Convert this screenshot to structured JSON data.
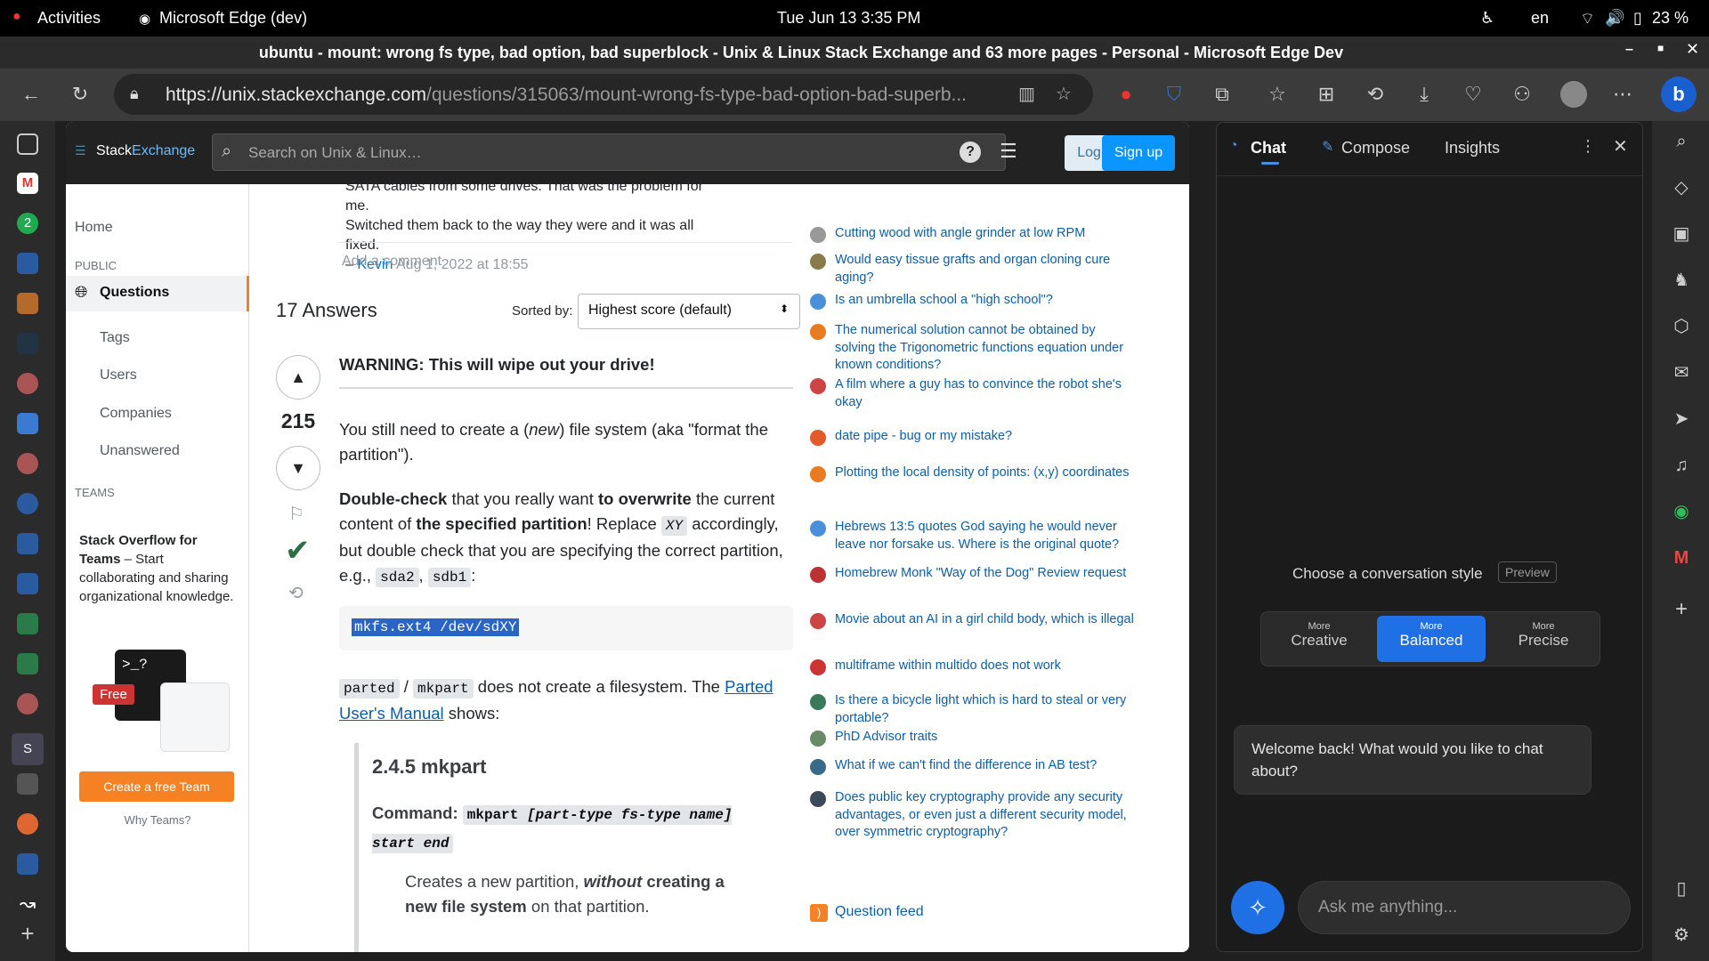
{
  "system": {
    "activities": "Activities",
    "app": "Microsoft Edge (dev)",
    "datetime": "Tue Jun 13  3:35 PM",
    "lang": "en",
    "battery": "23 %"
  },
  "window": {
    "title": "ubuntu - mount: wrong fs type, bad option, bad superblock - Unix & Linux Stack Exchange and 63 more pages - Personal - Microsoft Edge Dev"
  },
  "browser": {
    "url_host": "https://unix.stackexchange.com",
    "url_path": "/questions/315063/mount-wrong-fs-type-bad-option-bad-superb..."
  },
  "se": {
    "logo_a": "Stack",
    "logo_b": "Exchange",
    "search_placeholder": "Search on Unix & Linux…",
    "login": "Log in",
    "signup": "Sign up",
    "nav": {
      "home": "Home",
      "public": "PUBLIC",
      "questions": "Questions",
      "tags": "Tags",
      "users": "Users",
      "companies": "Companies",
      "unanswered": "Unanswered",
      "teams": "TEAMS"
    },
    "teams_box": {
      "title": "Stack Overflow for Teams",
      "text": " – Start collaborating and sharing organizational knowledge.",
      "free": "Free",
      "cta": "Create a free Team",
      "why": "Why Teams?"
    }
  },
  "comment": {
    "line1": "SATA cables from some drives. That was the problem for me.",
    "line2": "Switched them back to the way they were and it was all fixed.",
    "dash": "–",
    "author": "Kevin",
    "date": "Aug 1, 2022 at 18:55",
    "add": "Add a comment"
  },
  "answers": {
    "count": "17 Answers",
    "sorted_label": "Sorted by:",
    "sort_value": "Highest score (default)"
  },
  "answer": {
    "score": "215",
    "warning": "WARNING: This will wipe out your drive!",
    "p1_a": "You still need to create a (",
    "p1_em": "new",
    "p1_b": ") file system (aka \"format the partition\").",
    "p2_b1": "Double-check",
    "p2_t1": " that you really want ",
    "p2_b2": "to overwrite",
    "p2_t2": " the current content of ",
    "p2_b3": "the specified partition",
    "p2_t3": "!   Replace ",
    "p2_code1": "XY",
    "p2_t4": " accordingly, but double check that you are specifying the correct partition, e.g., ",
    "p2_code2": "sda2",
    "p2_comma": ", ",
    "p2_code3": "sdb1",
    "p2_colon": ":",
    "code_block": "mkfs.ext4 /dev/sdXY",
    "p3_code1": "parted",
    "p3_slash": " / ",
    "p3_code2": "mkpart",
    "p3_t1": " does not create a filesystem.  The ",
    "p3_link": "Parted User's Manual",
    "p3_t2": " shows:",
    "bq_heading": "2.4.5 mkpart",
    "bq_cmd_label": "Command:",
    "bq_cmd_code": "mkpart ",
    "bq_cmd_code_em": "[part-type fs-type name] start end",
    "bq_p_a": "Creates a new partition, ",
    "bq_p_em": "without",
    "bq_p_b": " creating a ",
    "bq_p_c": "new file system",
    "bq_p_d": " on that partition."
  },
  "hot": [
    {
      "title": "Cutting wood with angle grinder at low RPM",
      "color": "#999"
    },
    {
      "title": "Would easy tissue grafts and organ cloning cure aging?",
      "color": "#8a7a4a"
    },
    {
      "title": "Is an umbrella school a \"high school\"?",
      "color": "#4a90d9"
    },
    {
      "title": "The numerical solution cannot be obtained by solving the Trigonometric functions equation under known conditions?",
      "color": "#e87a22"
    },
    {
      "title": "A film where a guy has to convince the robot she's okay",
      "color": "#c44"
    },
    {
      "title": "date pipe - bug or my mistake?",
      "color": "#e35a2a"
    },
    {
      "title": "Plotting the local density of points: (x,y) coordinates",
      "color": "#e87a22"
    },
    {
      "title": "Hebrews 13:5 quotes God saying he would never leave nor forsake us. Where is the original quote?",
      "color": "#4a90d9"
    },
    {
      "title": "Homebrew Monk \"Way of the Dog\" Review request",
      "color": "#b33"
    },
    {
      "title": "Movie about an AI in a girl child body, which is illegal",
      "color": "#c44"
    },
    {
      "title": "multiframe within multido does not work",
      "color": "#c33"
    },
    {
      "title": "Is there a bicycle light which is hard to steal or very portable?",
      "color": "#3a7a5a"
    },
    {
      "title": "PhD Advisor traits",
      "color": "#6a8a6a"
    },
    {
      "title": "What if we can't find the difference in AB test?",
      "color": "#3a6a8a"
    },
    {
      "title": "Does public key cryptography provide any security advantages, or even just a different security model, over symmetric cryptography?",
      "color": "#3a4a5a"
    }
  ],
  "feed": "Question feed",
  "copilot": {
    "tab_chat": "Chat",
    "tab_compose": "Compose",
    "tab_insights": "Insights",
    "style_label": "Choose a conversation style",
    "preview": "Preview",
    "more": "More",
    "creative": "Creative",
    "balanced": "Balanced",
    "precise": "Precise",
    "welcome": "Welcome back! What would you like to chat about?",
    "ask_placeholder": "Ask me anything..."
  }
}
